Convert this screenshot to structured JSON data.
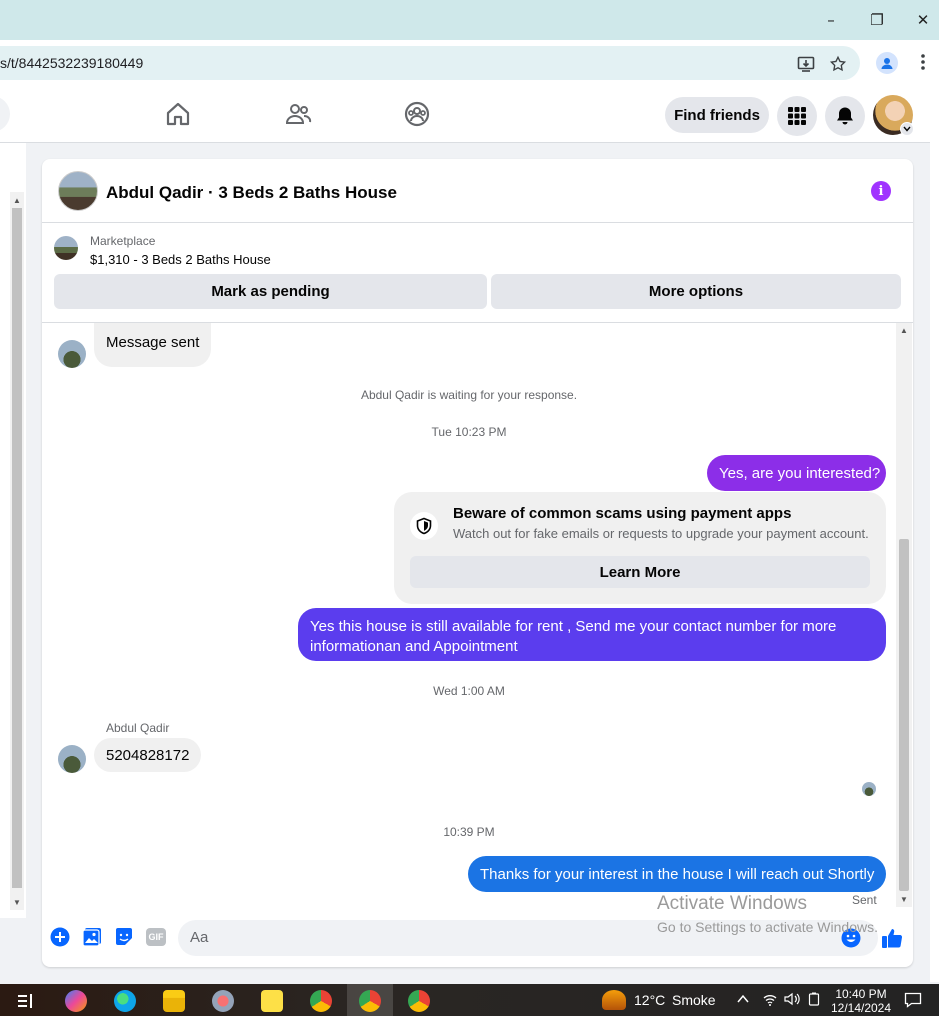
{
  "browser": {
    "url": "s/t/8442532239180449",
    "window_controls": [
      "–",
      "❐",
      "✕"
    ]
  },
  "nav": {
    "find_friends": "Find friends"
  },
  "chat": {
    "title": "Abdul Qadir · 3 Beds 2 Baths House",
    "listing": {
      "source": "Marketplace",
      "price_title": "$1,310 - 3 Beds 2 Baths House",
      "mark_pending": "Mark as pending",
      "more_options": "More options"
    },
    "messages": {
      "msg1": "Message sent",
      "waiting": "Abdul Qadir is waiting for your response.",
      "ts1": "Tue 10:23 PM",
      "out1": "Yes, are you interested?",
      "scam_title": "Beware of common scams using payment apps",
      "scam_sub": "Watch out for fake emails or requests to upgrade your payment account.",
      "learn_more": "Learn More",
      "out2": "Yes this house is still available for rent , Send me your contact number for more informationan and Appointment",
      "ts2": "Wed 1:00 AM",
      "sender": "Abdul Qadir",
      "in2": "5204828172",
      "ts3": "10:39 PM",
      "out3": "Thanks for your interest in the house I will reach out Shortly",
      "status": "Sent"
    },
    "composer": {
      "placeholder": "Aa",
      "gif": "GIF"
    }
  },
  "windows_watermark": {
    "line1": "Activate Windows",
    "line2": "Go to Settings to activate Windows."
  },
  "taskbar": {
    "weather_temp": "12°C",
    "weather_desc": "Smoke",
    "time": "10:40 PM",
    "date": "12/14/2024"
  },
  "colors": {
    "out_bubble_1": "#8c2ee8",
    "out_bubble_2": "#5b3dee",
    "out_bubble_3": "#1b74e4",
    "accent_blue": "#0866ff",
    "info_purple": "#a033ff"
  }
}
